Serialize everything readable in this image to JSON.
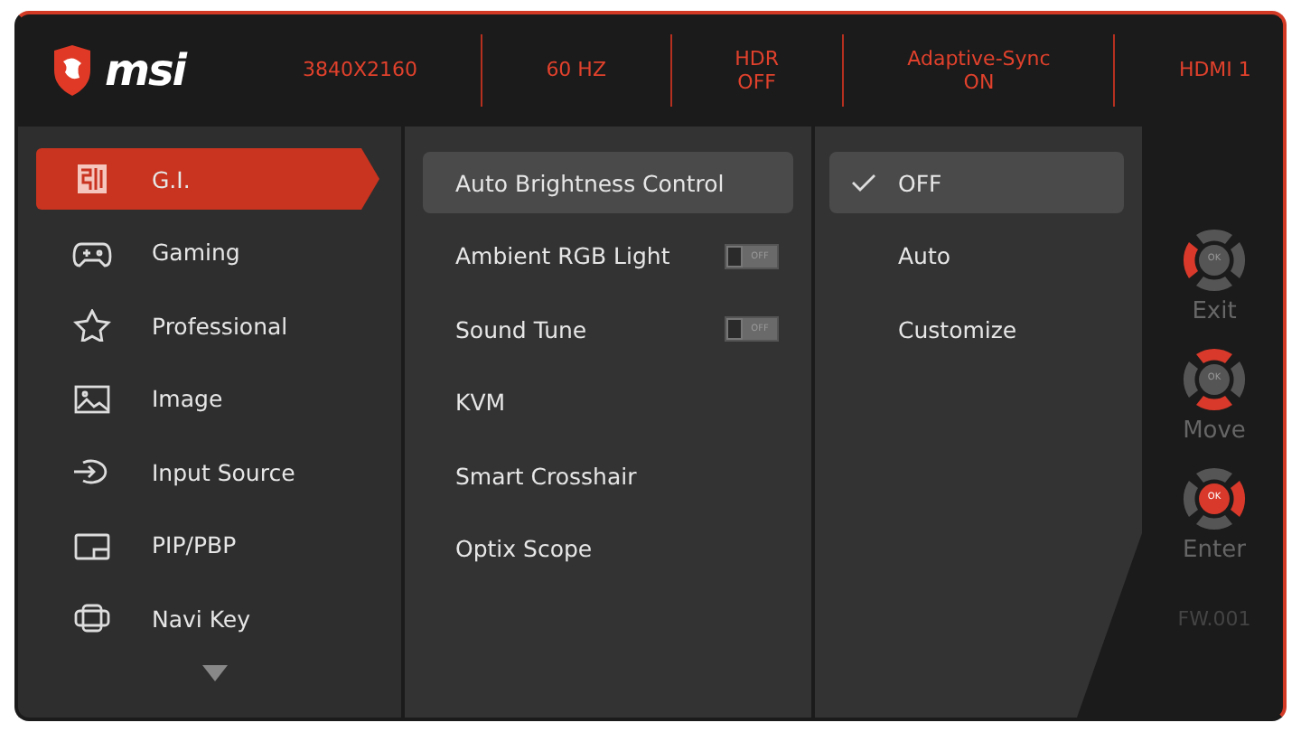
{
  "brand": {
    "name": "msi"
  },
  "status_bar": [
    {
      "label": "3840X2160"
    },
    {
      "label": "60 HZ"
    },
    {
      "label": "HDR\nOFF"
    },
    {
      "label": "Adaptive-Sync\nON"
    },
    {
      "label": "HDMI 1"
    }
  ],
  "sidebar": {
    "items": [
      {
        "label": "G.I.",
        "selected": true
      },
      {
        "label": "Gaming",
        "selected": false
      },
      {
        "label": "Professional",
        "selected": false
      },
      {
        "label": "Image",
        "selected": false
      },
      {
        "label": "Input Source",
        "selected": false
      },
      {
        "label": "PIP/PBP",
        "selected": false
      },
      {
        "label": "Navi Key",
        "selected": false
      }
    ],
    "more_below": true
  },
  "settings": [
    {
      "label": "Auto Brightness Control",
      "kind": "item",
      "selected": true
    },
    {
      "label": "Ambient RGB Light",
      "kind": "toggle",
      "selected": false,
      "toggle": {
        "on": false,
        "text": "OFF"
      }
    },
    {
      "label": "Sound Tune",
      "kind": "toggle",
      "selected": false,
      "toggle": {
        "on": false,
        "text": "OFF"
      }
    },
    {
      "label": "KVM",
      "kind": "item",
      "selected": false
    },
    {
      "label": "Smart Crosshair",
      "kind": "item",
      "selected": false
    },
    {
      "label": "Optix Scope",
      "kind": "item",
      "selected": false
    }
  ],
  "options": [
    {
      "label": "OFF",
      "selected": true
    },
    {
      "label": "Auto",
      "selected": false
    },
    {
      "label": "Customize",
      "selected": false
    }
  ],
  "keys": [
    {
      "label": "Exit",
      "center": "OK",
      "highlight": {
        "up": false,
        "down": false,
        "left": true,
        "right": false,
        "center": false
      }
    },
    {
      "label": "Move",
      "center": "OK",
      "highlight": {
        "up": true,
        "down": true,
        "left": false,
        "right": false,
        "center": false
      }
    },
    {
      "label": "Enter",
      "center": "OK",
      "highlight": {
        "up": false,
        "down": false,
        "left": false,
        "right": true,
        "center": true
      }
    }
  ],
  "firmware": "FW.001"
}
